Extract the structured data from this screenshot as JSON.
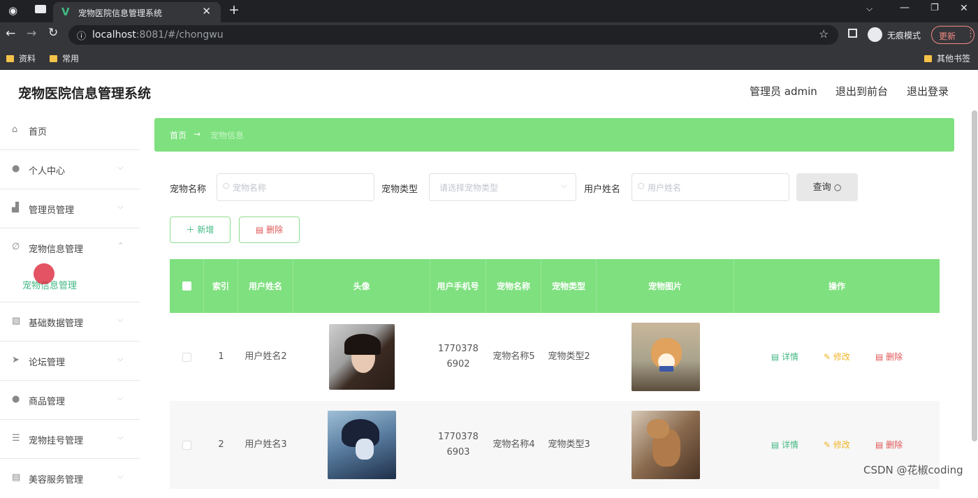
{
  "browser": {
    "tab_title": "宠物医院信息管理系统",
    "url_host": "localhost",
    "url_rest": ":8081/#/chongwu",
    "incognito_label": "无痕模式",
    "update_label": "更新",
    "bookmarks": [
      "资料",
      "常用"
    ],
    "other_bookmarks": "其他书签"
  },
  "header": {
    "title": "宠物医院信息管理系统",
    "user": "管理员 admin",
    "front": "退出到前台",
    "logout": "退出登录"
  },
  "sidebar": {
    "items": [
      {
        "label": "首页",
        "icon": "home-icon"
      },
      {
        "label": "个人中心",
        "icon": "person-icon"
      },
      {
        "label": "管理员管理",
        "icon": "admin-icon"
      },
      {
        "label": "宠物信息管理",
        "icon": "bell-icon"
      },
      {
        "label": "基础数据管理",
        "icon": "chart-icon"
      },
      {
        "label": "论坛管理",
        "icon": "send-icon"
      },
      {
        "label": "商品管理",
        "icon": "person-icon"
      },
      {
        "label": "宠物挂号管理",
        "icon": "list-icon"
      },
      {
        "label": "美容服务管理",
        "icon": "doc-icon"
      }
    ],
    "sub_item": "宠物信息管理"
  },
  "breadcrumb": {
    "home": "首页",
    "arrow": "→",
    "current": "宠物信息"
  },
  "filters": {
    "pet_name_label": "宠物名称",
    "pet_name_placeholder": "宠物名称",
    "pet_type_label": "宠物类型",
    "pet_type_placeholder": "请选择宠物类型",
    "user_name_label": "用户姓名",
    "user_name_placeholder": "用户姓名",
    "search_label": "查询"
  },
  "actions": {
    "add": "新增",
    "delete": "删除"
  },
  "table": {
    "headers": [
      "索引",
      "用户姓名",
      "头像",
      "用户手机号",
      "宠物名称",
      "宠物类型",
      "宠物图片",
      "操作"
    ],
    "rows": [
      {
        "index": "1",
        "user": "用户姓名2",
        "phone": "17703786902",
        "pet_name": "宠物名称5",
        "pet_type": "宠物类型2"
      },
      {
        "index": "2",
        "user": "用户姓名3",
        "phone": "17703786903",
        "pet_name": "宠物名称4",
        "pet_type": "宠物类型3"
      }
    ],
    "ops": {
      "detail": "详情",
      "edit": "修改",
      "delete": "删除"
    }
  },
  "watermark": "CSDN @花椒coding",
  "colors": {
    "accent": "#7ee07e",
    "link": "#41b883",
    "edit": "#f0b429",
    "danger": "#e05555"
  }
}
